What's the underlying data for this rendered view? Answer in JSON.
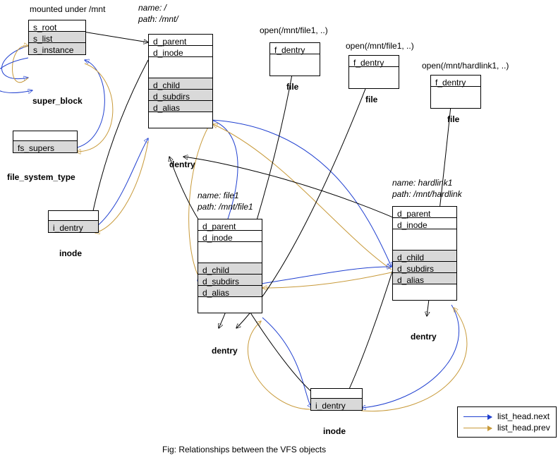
{
  "labels": {
    "mounted_under": "mounted under /mnt",
    "super_block": "super_block",
    "file_system_type": "file_system_type",
    "inode": "inode",
    "dentry": "dentry",
    "file": "file",
    "fig_caption": "Fig: Relationships between the VFS objects"
  },
  "super_block": {
    "fields": [
      "s_root",
      "s_list",
      "s_instance"
    ]
  },
  "file_system_type": {
    "fields": [
      "fs_supers"
    ]
  },
  "inode_top": {
    "fields": [
      "i_dentry"
    ]
  },
  "inode_bottom": {
    "fields": [
      "i_dentry"
    ]
  },
  "dentry_root": {
    "title_name": "name: /",
    "title_path": "path: /mnt/",
    "fields_top": [
      "d_parent",
      "d_inode"
    ],
    "fields_shaded": [
      "d_child",
      "d_subdirs",
      "d_alias"
    ]
  },
  "dentry_file1": {
    "title_name": "name: file1",
    "title_path": "path: /mnt/file1",
    "fields_top": [
      "d_parent",
      "d_inode"
    ],
    "fields_shaded": [
      "d_child",
      "d_subdirs",
      "d_alias"
    ]
  },
  "dentry_hardlink1": {
    "title_name": "name: hardlink1",
    "title_path": "path: /mnt/hardlink",
    "fields_top": [
      "d_parent",
      "d_inode"
    ],
    "fields_shaded": [
      "d_child",
      "d_subdirs",
      "d_alias"
    ]
  },
  "file1": {
    "label": "f_dentry",
    "open": "open(/mnt/file1, ..)"
  },
  "file2": {
    "label": "f_dentry",
    "open": "open(/mnt/file1, ..)"
  },
  "file3": {
    "label": "f_dentry",
    "open": "open(/mnt/hardlink1, ..)"
  },
  "legend": {
    "next": "list_head.next",
    "prev": "list_head.prev"
  }
}
